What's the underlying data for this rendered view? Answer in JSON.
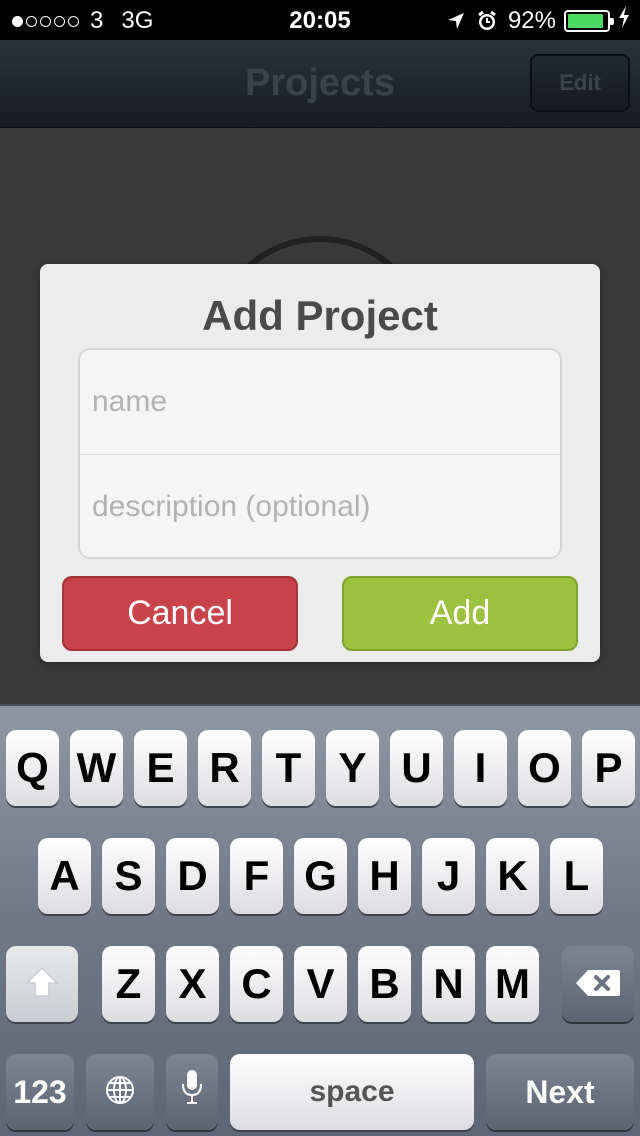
{
  "status_bar": {
    "carrier": "3",
    "network": "3G",
    "time": "20:05",
    "battery_percent": "92%",
    "battery_level": 0.92,
    "signal_bars_filled": 1,
    "signal_bars_total": 5,
    "icons": [
      "location-arrow-icon",
      "alarm-icon",
      "battery-icon",
      "charging-bolt-icon"
    ]
  },
  "nav": {
    "title": "Projects",
    "edit_label": "Edit"
  },
  "dialog": {
    "title": "Add Project",
    "name_placeholder": "name",
    "name_value": "",
    "description_placeholder": "description (optional)",
    "description_value": "",
    "cancel_label": "Cancel",
    "add_label": "Add"
  },
  "keyboard": {
    "row1": [
      "Q",
      "W",
      "E",
      "R",
      "T",
      "Y",
      "U",
      "I",
      "O",
      "P"
    ],
    "row2": [
      "A",
      "S",
      "D",
      "F",
      "G",
      "H",
      "J",
      "K",
      "L"
    ],
    "row3": [
      "Z",
      "X",
      "C",
      "V",
      "B",
      "N",
      "M"
    ],
    "numbers_label": "123",
    "space_label": "space",
    "next_label": "Next",
    "icons": [
      "shift-icon",
      "backspace-icon",
      "globe-icon",
      "microphone-icon"
    ]
  },
  "colors": {
    "cancel": "#c8434a",
    "add": "#9dc240",
    "battery": "#4cd964"
  }
}
